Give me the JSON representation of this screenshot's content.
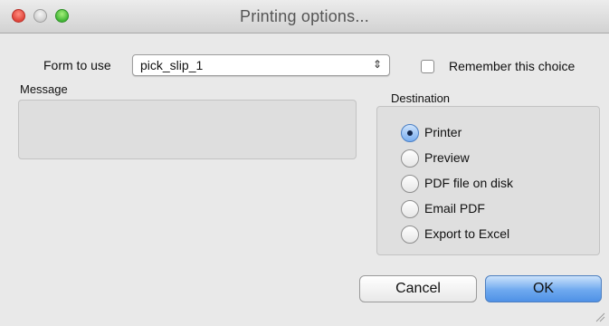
{
  "window": {
    "title": "Printing options..."
  },
  "form": {
    "label": "Form to use",
    "selected": "pick_slip_1",
    "select_arrows": "⇕",
    "remember_label": "Remember this choice",
    "remember_checked": false
  },
  "message": {
    "label": "Message",
    "text": ""
  },
  "destination": {
    "label": "Destination",
    "options": [
      {
        "label": "Printer",
        "selected": true
      },
      {
        "label": "Preview",
        "selected": false
      },
      {
        "label": "PDF file on disk",
        "selected": false
      },
      {
        "label": "Email PDF",
        "selected": false
      },
      {
        "label": "Export to Excel",
        "selected": false
      }
    ]
  },
  "buttons": {
    "cancel": "Cancel",
    "ok": "OK"
  }
}
